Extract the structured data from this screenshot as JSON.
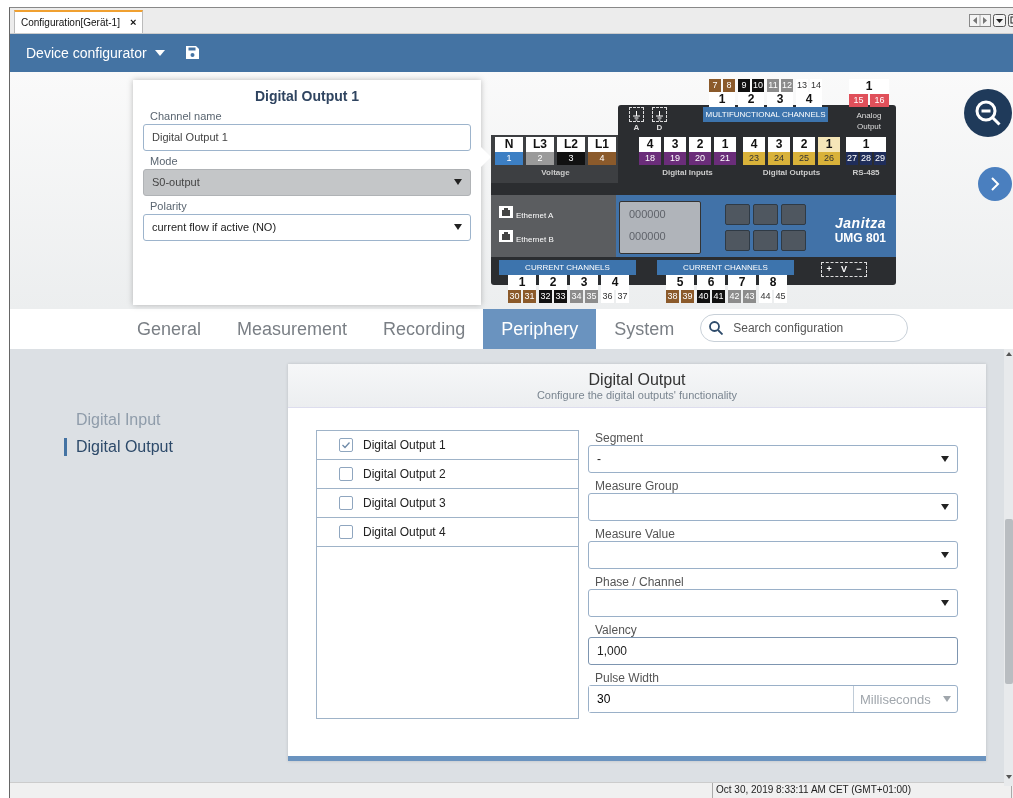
{
  "tab_strip": {
    "tabs": [
      {
        "label": "Configuration[Gerät-1]",
        "close": "×",
        "selected": true
      }
    ]
  },
  "header": {
    "title": "Device configurator"
  },
  "channel_popup": {
    "title": "Digital Output 1",
    "fields": [
      {
        "kind": "text",
        "label": "Channel name",
        "value": "Digital Output 1",
        "disabled": false
      },
      {
        "kind": "select",
        "label": "Mode",
        "value": "S0-output",
        "disabled": true
      },
      {
        "kind": "select",
        "label": "Polarity",
        "value": "current flow if active (NO)",
        "disabled": false
      }
    ]
  },
  "device": {
    "brand": "Janitza",
    "model": "UMG 801",
    "display_lines": [
      "000000",
      "000000"
    ],
    "ethernet_ports": [
      "Ethernet A",
      "Ethernet B"
    ],
    "ground_labels": [
      "A",
      "D"
    ],
    "supply_labels": [
      "+",
      "V",
      "−"
    ],
    "terminal_groups": [
      {
        "caption": "MULTIFUNCTIONAL CHANNELS",
        "banner": true,
        "pins_above": true,
        "terminals": [
          {
            "number": "1",
            "selected": false,
            "pins": [
              {
                "text": "7",
                "color": "#8b5a2b"
              },
              {
                "text": "8",
                "color": "#8b5a2b"
              }
            ]
          },
          {
            "number": "2",
            "selected": false,
            "pins": [
              {
                "text": "9",
                "color": "#111111"
              },
              {
                "text": "10",
                "color": "#111111"
              }
            ]
          },
          {
            "number": "3",
            "selected": false,
            "pins": [
              {
                "text": "11",
                "color": "#8c8c8c"
              },
              {
                "text": "12",
                "color": "#8c8c8c"
              }
            ]
          },
          {
            "number": "4",
            "selected": false,
            "pins": [
              {
                "text": "13",
                "color": "#ffffff"
              },
              {
                "text": "14",
                "color": "#ffffff"
              }
            ]
          }
        ]
      },
      {
        "caption": "Analog Output",
        "banner": false,
        "pins_above": false,
        "terminals": [
          {
            "number": "1",
            "selected": false,
            "pins": [
              {
                "text": "15",
                "color": "#e0505a"
              },
              {
                "text": "16",
                "color": "#e0505a"
              }
            ]
          }
        ]
      },
      {
        "caption": "Voltage",
        "banner": false,
        "pins_above": false,
        "terminals": [
          {
            "number": "N",
            "selected": false,
            "pins": [
              {
                "text": "1",
                "color": "#3c7fc4"
              }
            ]
          },
          {
            "number": "L3",
            "selected": false,
            "pins": [
              {
                "text": "2",
                "color": "#9a9a9a"
              }
            ]
          },
          {
            "number": "L2",
            "selected": false,
            "pins": [
              {
                "text": "3",
                "color": "#111111"
              }
            ]
          },
          {
            "number": "L1",
            "selected": false,
            "pins": [
              {
                "text": "4",
                "color": "#8b5a2b"
              }
            ]
          }
        ]
      },
      {
        "caption": "Digital Inputs",
        "banner": false,
        "pins_above": false,
        "terminals": [
          {
            "number": "4",
            "selected": false,
            "pins": [
              {
                "text": "18",
                "color": "#6b2d7a"
              }
            ]
          },
          {
            "number": "3",
            "selected": false,
            "pins": [
              {
                "text": "19",
                "color": "#6b2d7a"
              }
            ]
          },
          {
            "number": "2",
            "selected": false,
            "pins": [
              {
                "text": "20",
                "color": "#6b2d7a"
              }
            ]
          },
          {
            "number": "1",
            "selected": false,
            "pins": [
              {
                "text": "21",
                "color": "#6b2d7a"
              }
            ]
          }
        ]
      },
      {
        "caption": "Digital Outputs",
        "banner": false,
        "pins_above": false,
        "terminals": [
          {
            "number": "4",
            "selected": false,
            "pins": [
              {
                "text": "23",
                "color": "#d9b23a"
              }
            ]
          },
          {
            "number": "3",
            "selected": false,
            "pins": [
              {
                "text": "24",
                "color": "#d9b23a"
              }
            ]
          },
          {
            "number": "2",
            "selected": false,
            "pins": [
              {
                "text": "25",
                "color": "#d9b23a"
              }
            ]
          },
          {
            "number": "1",
            "selected": true,
            "pins": [
              {
                "text": "26",
                "color": "#d9b23a"
              }
            ]
          }
        ]
      },
      {
        "caption": "RS-485",
        "banner": false,
        "pins_above": false,
        "terminals": [
          {
            "number": "1",
            "selected": false,
            "pins": [
              {
                "text": "27",
                "color": "#1f2d5a"
              },
              {
                "text": "28",
                "color": "#1f2d5a"
              },
              {
                "text": "29",
                "color": "#1f2d5a"
              }
            ]
          }
        ]
      },
      {
        "caption": "CURRENT CHANNELS",
        "banner": true,
        "pins_above": false,
        "terminals": [
          {
            "number": "1",
            "selected": false,
            "pins": [
              {
                "text": "30",
                "color": "#8b5a2b"
              },
              {
                "text": "31",
                "color": "#8b5a2b"
              }
            ]
          },
          {
            "number": "2",
            "selected": false,
            "pins": [
              {
                "text": "32",
                "color": "#111111"
              },
              {
                "text": "33",
                "color": "#111111"
              }
            ]
          },
          {
            "number": "3",
            "selected": false,
            "pins": [
              {
                "text": "34",
                "color": "#8c8c8c"
              },
              {
                "text": "35",
                "color": "#8c8c8c"
              }
            ]
          },
          {
            "number": "4",
            "selected": false,
            "pins": [
              {
                "text": "36",
                "color": "#ffffff"
              },
              {
                "text": "37",
                "color": "#ffffff"
              }
            ]
          }
        ]
      },
      {
        "caption": "CURRENT CHANNELS",
        "banner": true,
        "pins_above": false,
        "terminals": [
          {
            "number": "5",
            "selected": false,
            "pins": [
              {
                "text": "38",
                "color": "#8b5a2b"
              },
              {
                "text": "39",
                "color": "#8b5a2b"
              }
            ]
          },
          {
            "number": "6",
            "selected": false,
            "pins": [
              {
                "text": "40",
                "color": "#111111"
              },
              {
                "text": "41",
                "color": "#111111"
              }
            ]
          },
          {
            "number": "7",
            "selected": false,
            "pins": [
              {
                "text": "42",
                "color": "#8c8c8c"
              },
              {
                "text": "43",
                "color": "#8c8c8c"
              }
            ]
          },
          {
            "number": "8",
            "selected": false,
            "pins": [
              {
                "text": "44",
                "color": "#ffffff"
              },
              {
                "text": "45",
                "color": "#ffffff"
              }
            ]
          }
        ]
      }
    ]
  },
  "main_tabs": [
    {
      "label": "General",
      "selected": false
    },
    {
      "label": "Measurement",
      "selected": false
    },
    {
      "label": "Recording",
      "selected": false
    },
    {
      "label": "Periphery",
      "selected": true
    },
    {
      "label": "System",
      "selected": false
    }
  ],
  "search": {
    "placeholder": "Search configuration"
  },
  "side_nav": {
    "items": [
      {
        "label": "Digital Input",
        "selected": false
      },
      {
        "label": "Digital Output",
        "selected": true
      }
    ]
  },
  "card": {
    "title": "Digital Output",
    "subtitle": "Configure the digital outputs' functionality",
    "outputs": [
      {
        "label": "Digital Output 1",
        "checked": true
      },
      {
        "label": "Digital Output 2",
        "checked": false
      },
      {
        "label": "Digital Output 3",
        "checked": false
      },
      {
        "label": "Digital Output 4",
        "checked": false
      }
    ],
    "fields": [
      {
        "kind": "select",
        "label": "Segment",
        "value": "-"
      },
      {
        "kind": "select",
        "label": "Measure Group"
      },
      {
        "kind": "select",
        "label": "Measure Value"
      },
      {
        "kind": "select",
        "label": "Phase / Channel"
      },
      {
        "kind": "input",
        "label": "Valency",
        "value": "1,000"
      },
      {
        "kind": "input_unit",
        "label": "Pulse Width",
        "value": "30",
        "unit": "Milliseconds",
        "unit_disabled": true
      }
    ]
  },
  "status_bar": {
    "text": "Oct 30, 2019 8:33:11 AM CET (GMT+01:00)"
  }
}
